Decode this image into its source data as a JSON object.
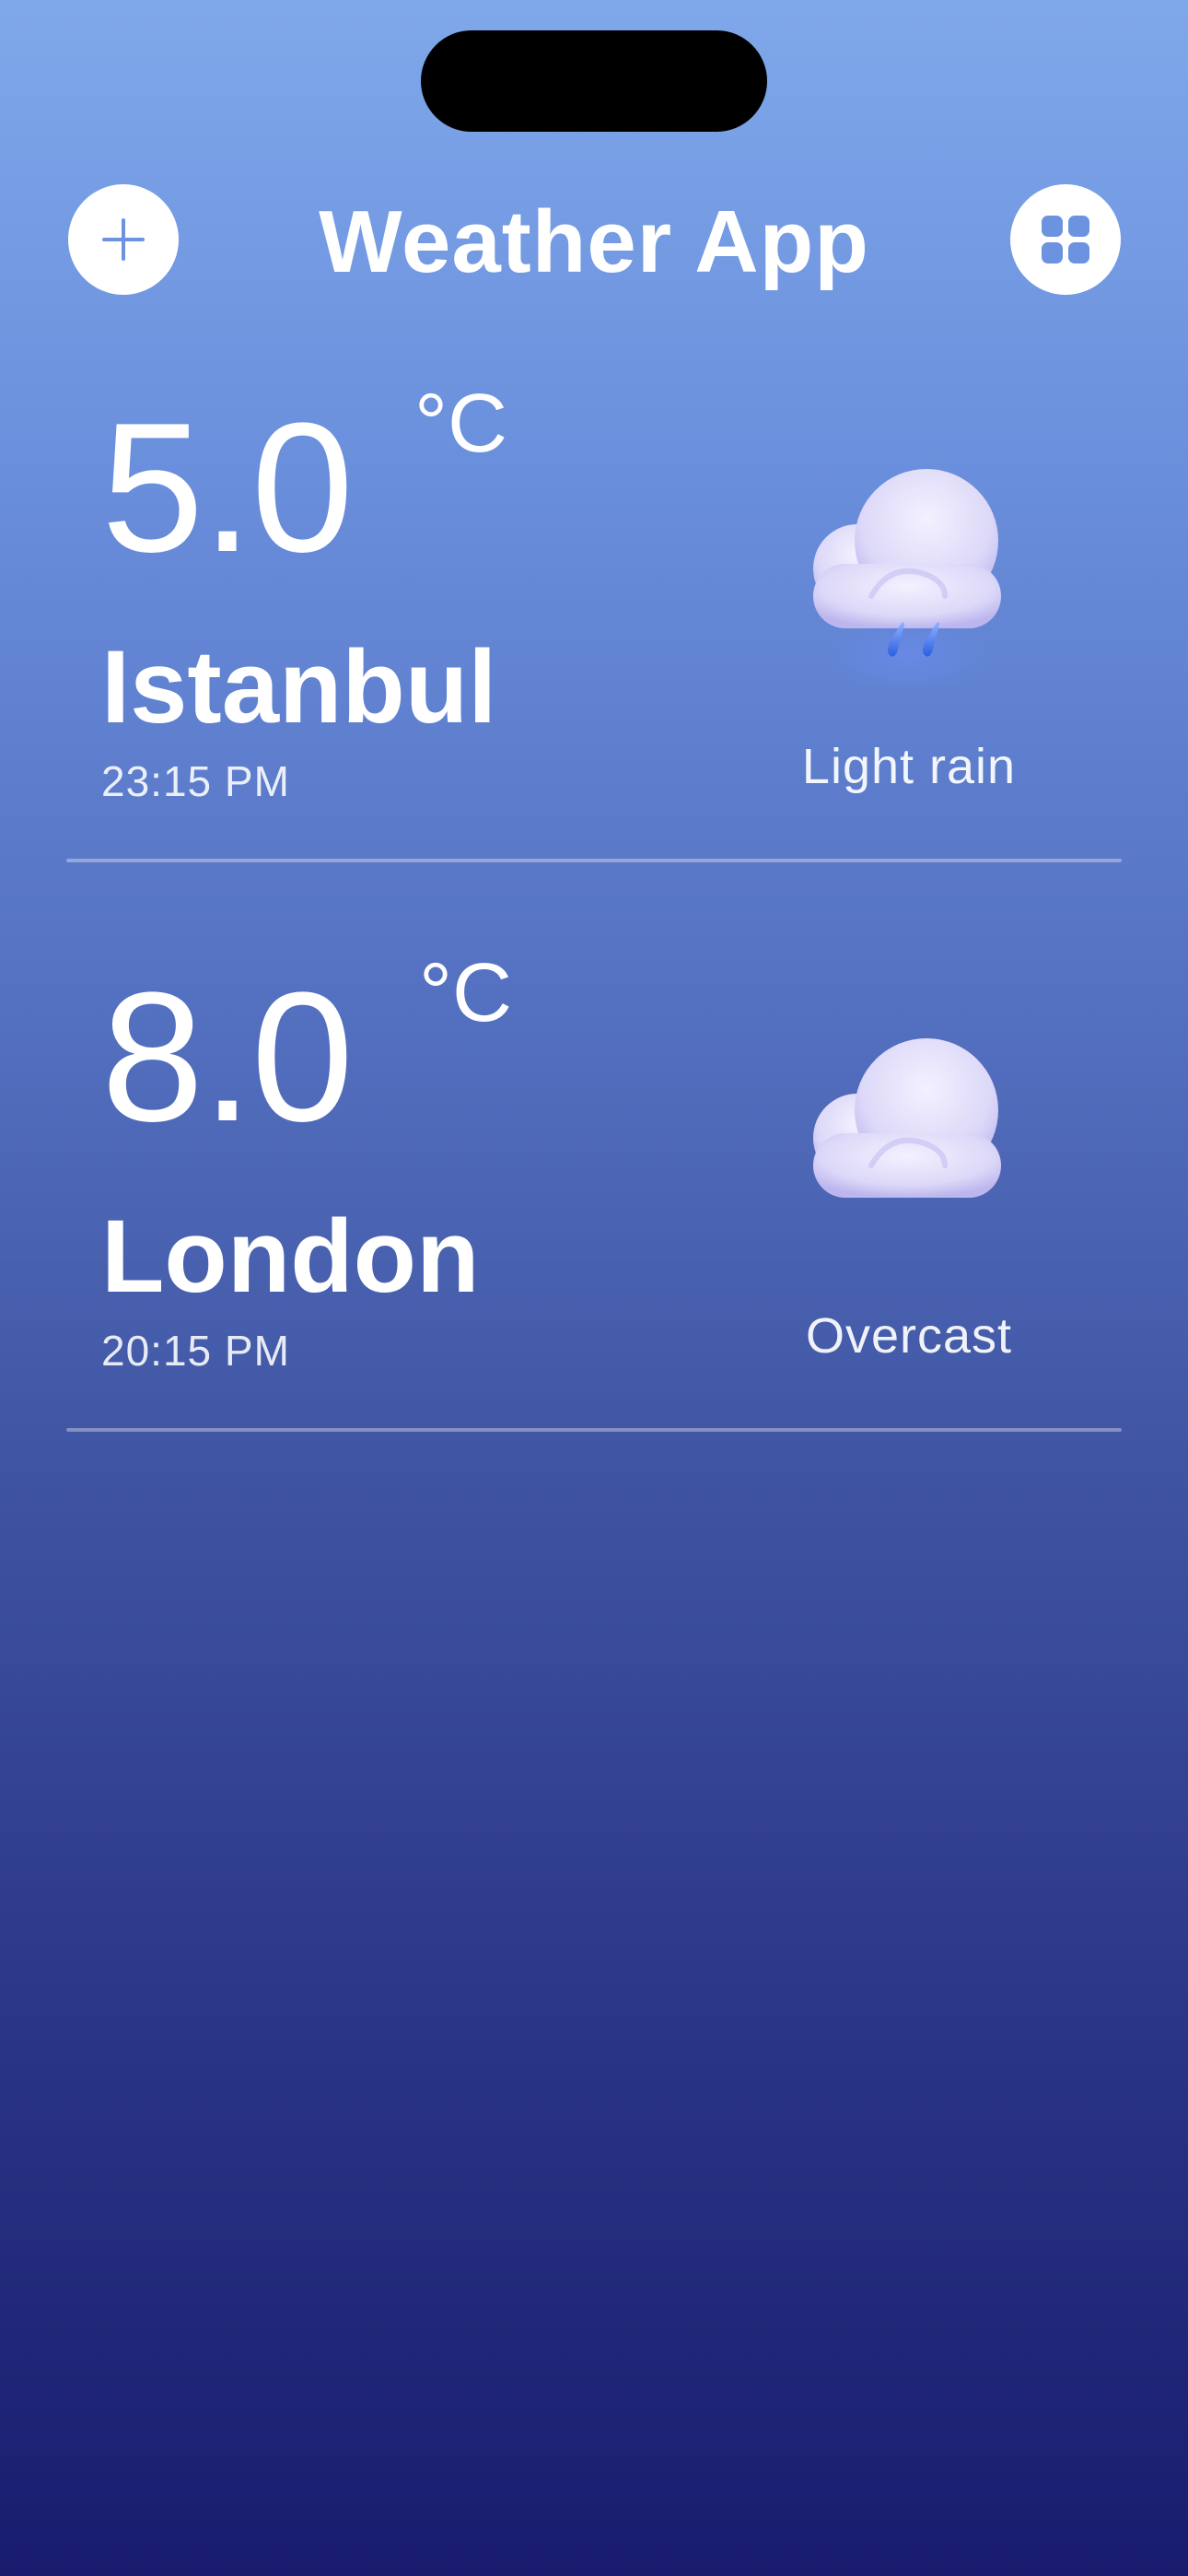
{
  "header": {
    "title": "Weather App",
    "add_icon": "plus-icon",
    "menu_icon": "grid-icon"
  },
  "cities": [
    {
      "temperature": "5.0",
      "unit": "°C",
      "name": "Istanbul",
      "time": "23:15 PM",
      "condition": "Light rain",
      "icon": "cloud-rain-icon"
    },
    {
      "temperature": "8.0",
      "unit": "°C",
      "name": "London",
      "time": "20:15 PM",
      "condition": "Overcast",
      "icon": "cloud-icon"
    }
  ],
  "colors": {
    "gradient_top": "#7fa8ea",
    "gradient_bottom": "#191c6e",
    "accent_icon": "#6b93e0",
    "cloud": "#dcd8f8",
    "rain": "#3a6ee8"
  }
}
